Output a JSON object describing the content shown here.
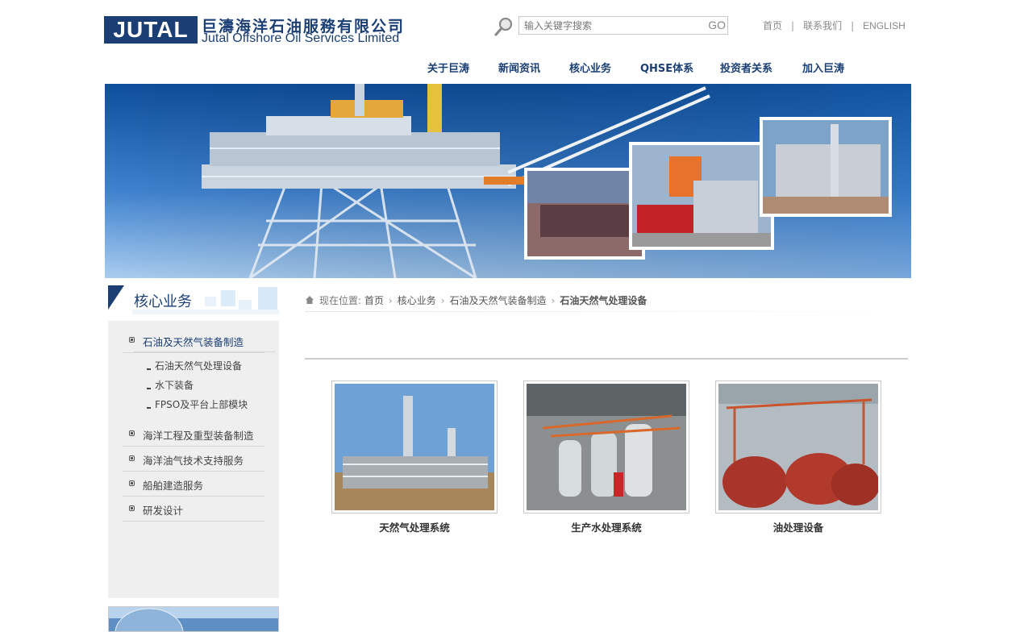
{
  "header": {
    "logo_mark": "JUTAL",
    "logo_cn": "巨濤海洋石油服務有限公司",
    "logo_en": "Jutal Offshore Oil Services Limited",
    "search_placeholder": "输入关键字搜索",
    "search_go": "GO",
    "top_links": [
      "首页",
      "联系我们",
      "ENGLISH"
    ],
    "nav": [
      "关于巨涛",
      "新闻资讯",
      "核心业务",
      "QHSE体系",
      "投资者关系",
      "加入巨涛"
    ]
  },
  "sidebar": {
    "title": "核心业务",
    "items": [
      {
        "label": "石油及天然气装备制造",
        "active": true,
        "children": [
          "石油天然气处理设备",
          "水下装备",
          "FPSO及平台上部模块"
        ]
      },
      {
        "label": "海洋工程及重型装备制造"
      },
      {
        "label": "海洋油气技术支持服务"
      },
      {
        "label": "船舶建造服务"
      },
      {
        "label": "研发设计"
      }
    ]
  },
  "breadcrumb": {
    "prefix": "现在位置:",
    "items": [
      "首页",
      "核心业务",
      "石油及天然气装备制造",
      "石油天然气处理设备"
    ]
  },
  "products": [
    {
      "caption": "天然气处理系统"
    },
    {
      "caption": "生产水处理系统"
    },
    {
      "caption": "油处理设备"
    }
  ],
  "colors": {
    "brand_blue": "#1b3f75",
    "sky": "#3a78c2",
    "panel_gray": "#efefef"
  }
}
